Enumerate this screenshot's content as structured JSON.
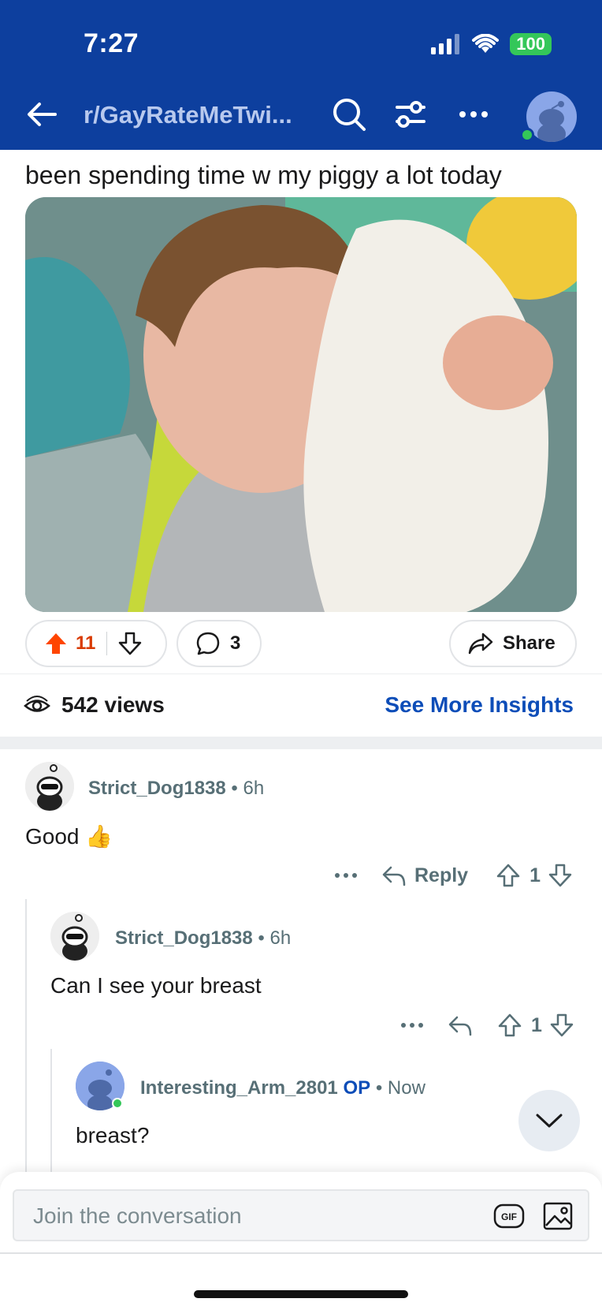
{
  "status_bar": {
    "time": "7:27",
    "battery": "100"
  },
  "nav": {
    "subreddit": "r/GayRateMeTwi..."
  },
  "post": {
    "title": "been spending time w my piggy a lot today",
    "upvotes": "11",
    "comments": "3",
    "share_label": "Share"
  },
  "insights": {
    "views": "542 views",
    "link": "See More Insights"
  },
  "comments": [
    {
      "user": "Strict_Dog1838",
      "sep": "•",
      "time": "6h",
      "body": "Good 👍",
      "reply_label": "Reply",
      "score": "1"
    },
    {
      "user": "Strict_Dog1838",
      "sep": "•",
      "time": "6h",
      "body": "Can I see your breast",
      "score": "1"
    },
    {
      "user": "Interesting_Arm_2801",
      "op": "OP",
      "sep": "•",
      "time": "Now",
      "body": "breast?"
    }
  ],
  "composer": {
    "placeholder": "Join the conversation",
    "gif": "GIF"
  },
  "colors": {
    "header_bg": "#0d3f9e",
    "upvote": "#ff4500",
    "link": "#0d4db8"
  }
}
